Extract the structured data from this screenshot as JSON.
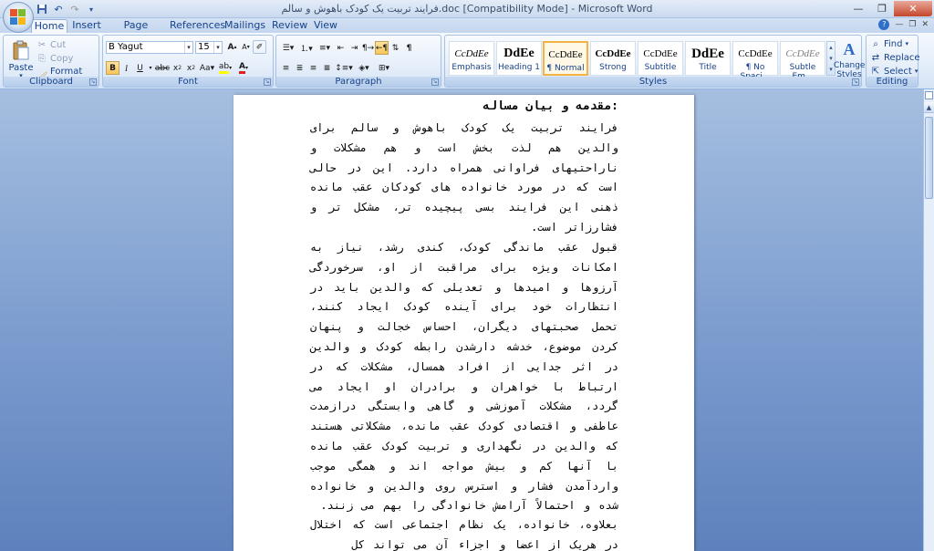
{
  "window": {
    "title": "فرایند تربیت یک کودک باهوش و سالم.doc [Compatibility Mode] - Microsoft Word"
  },
  "qat": {
    "save_icon": "save-icon",
    "undo_icon": "undo-icon",
    "redo_icon": "redo-icon",
    "customize_icon": "customize-qat-icon"
  },
  "tabs": [
    {
      "label": "Home"
    },
    {
      "label": "Insert"
    },
    {
      "label": "Page Layout"
    },
    {
      "label": "References"
    },
    {
      "label": "Mailings"
    },
    {
      "label": "Review"
    },
    {
      "label": "View"
    }
  ],
  "clipboard": {
    "paste_label": "Paste",
    "cut_label": "Cut",
    "copy_label": "Copy",
    "format_painter_label": "Format Painter",
    "group_label": "Clipboard"
  },
  "font": {
    "family_value": "B Yagut",
    "size_value": "15",
    "group_label": "Font",
    "highlight_color": "#ffff00",
    "font_color": "#e02020"
  },
  "paragraph": {
    "group_label": "Paragraph"
  },
  "styles": {
    "group_label": "Styles",
    "items": [
      {
        "sample": "CcDdEe",
        "name": "Emphasis"
      },
      {
        "sample": "DdEe",
        "name": "Heading 1"
      },
      {
        "sample": "CcDdEe",
        "name": "¶ Normal"
      },
      {
        "sample": "CcDdEe",
        "name": "Strong"
      },
      {
        "sample": "CcDdEe",
        "name": "Subtitle"
      },
      {
        "sample": "DdEe",
        "name": "Title"
      },
      {
        "sample": "CcDdEe",
        "name": "¶ No Spaci..."
      },
      {
        "sample": "CcDdEe",
        "name": "Subtle Em..."
      }
    ],
    "change_styles_label": "Change Styles"
  },
  "editing": {
    "group_label": "Editing",
    "find_label": "Find",
    "replace_label": "Replace",
    "select_label": "Select"
  },
  "document": {
    "heading": "مقدمه و بیان مساله:",
    "paragraphs": [
      "فرایند تربیت یک کودک باهوش و سالم برای والدین هم لذت بخش است و هم مشکلات و ناراحتیهای فراوانی همراه دارد. این در حالی است که در مورد خانواده های کودکان عقب مانده ذهنی این فرایند بسی پیچیده تر، مشکل تر و فشارزاتر است.",
      "قبول عقب ماندگی کودک، کندی رشد، نیاز به امکانات ویژه برای مراقبت از او، سرخوردگی آرزوها و امیدها و تعدیلی که والدین باید در انتظارات خود برای آینده کودک ایجاد کنند، تحمل صحبتهای دیگران، احساس خجالت و پنهان کردن موضوع، خدشه دارشدن رابطه کودک و والدین در اثر جدایی از افراد همسال، مشکلات که در ارتباط با خواهران و برادران او ایجاد می گردد، مشکلات آموزشی و گاهی وابستگی درازمدت عاطفی و اقتصادی کودک عقب مانده، مشکلاتی هستند که والدین در نگهداری و تربیت کودک عقب مانده با آنها کم و بیش مواجه اند و همگی موجب واردآمدن فشار و استرس روی والدین و خانواده شده و احتمالاً آرامش خانوادگی را بهم می زنند.",
      "بعلاوه، خانواده، یک نظام اجتماعی است که اختلال در هریک از اعضا و اجزاء آن می تواند کل"
    ]
  }
}
